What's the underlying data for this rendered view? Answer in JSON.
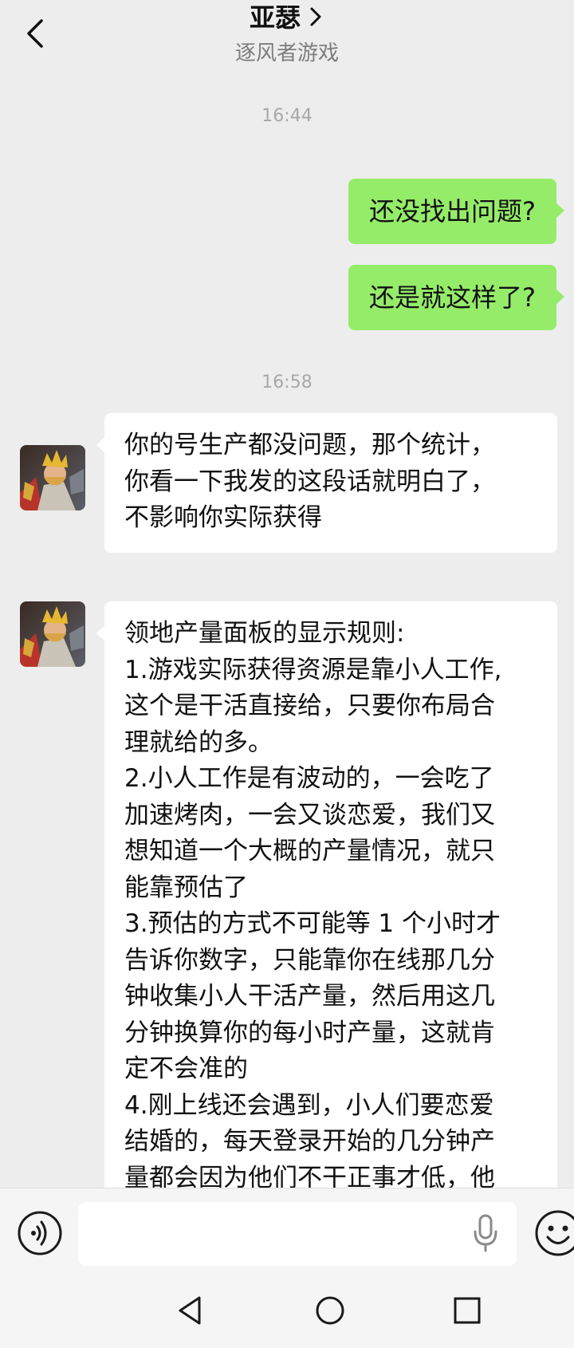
{
  "header": {
    "title": "亚瑟",
    "subtitle": "逐风者游戏"
  },
  "messages": [
    {
      "type": "timestamp",
      "text": "16:44"
    },
    {
      "type": "outgoing",
      "text": "还没找出问题?"
    },
    {
      "type": "outgoing",
      "text": "还是就这样了?"
    },
    {
      "type": "timestamp",
      "text": "16:58"
    },
    {
      "type": "incoming",
      "lines": [
        "你的号生产都没问题，那个统计，",
        "你看一下我发的这段话就明白了，",
        "不影响你实际获得"
      ]
    },
    {
      "type": "incoming",
      "lines": [
        "领地产量面板的显示规则:",
        "1.游戏实际获得资源是靠小人工作,",
        "这个是干活直接给，只要你布局合",
        "理就给的多。",
        "2.小人工作是有波动的，一会吃了",
        "加速烤肉，一会又谈恋爱，我们又",
        "想知道一个大概的产量情况，就只",
        "能靠预估了",
        "3.预估的方式不可能等 1 个小时才",
        "告诉你数字，只能靠你在线那几分",
        "钟收集小人干活产量，然后用这几",
        "分钟换算你的每小时产量，这就肯",
        "定不会准的",
        "4.刚上线还会遇到，小人们要恋爱",
        "结婚的，每天登录开始的几分钟产",
        "量都会因为他们不干正事才低，他"
      ]
    }
  ],
  "input": {
    "placeholder": ""
  },
  "icons": {
    "back": "chevron-left-icon",
    "title_more": "chevron-right-icon",
    "voice": "voice-icon",
    "mic": "microphone-icon",
    "emoji": "emoji-icon",
    "nav_back": "triangle-back-icon",
    "nav_home": "circle-home-icon",
    "nav_recents": "square-recents-icon"
  },
  "colors": {
    "background": "#ededed",
    "outgoing_bubble": "#95ec69",
    "incoming_bubble": "#ffffff",
    "timestamp": "#a8a8a8"
  }
}
